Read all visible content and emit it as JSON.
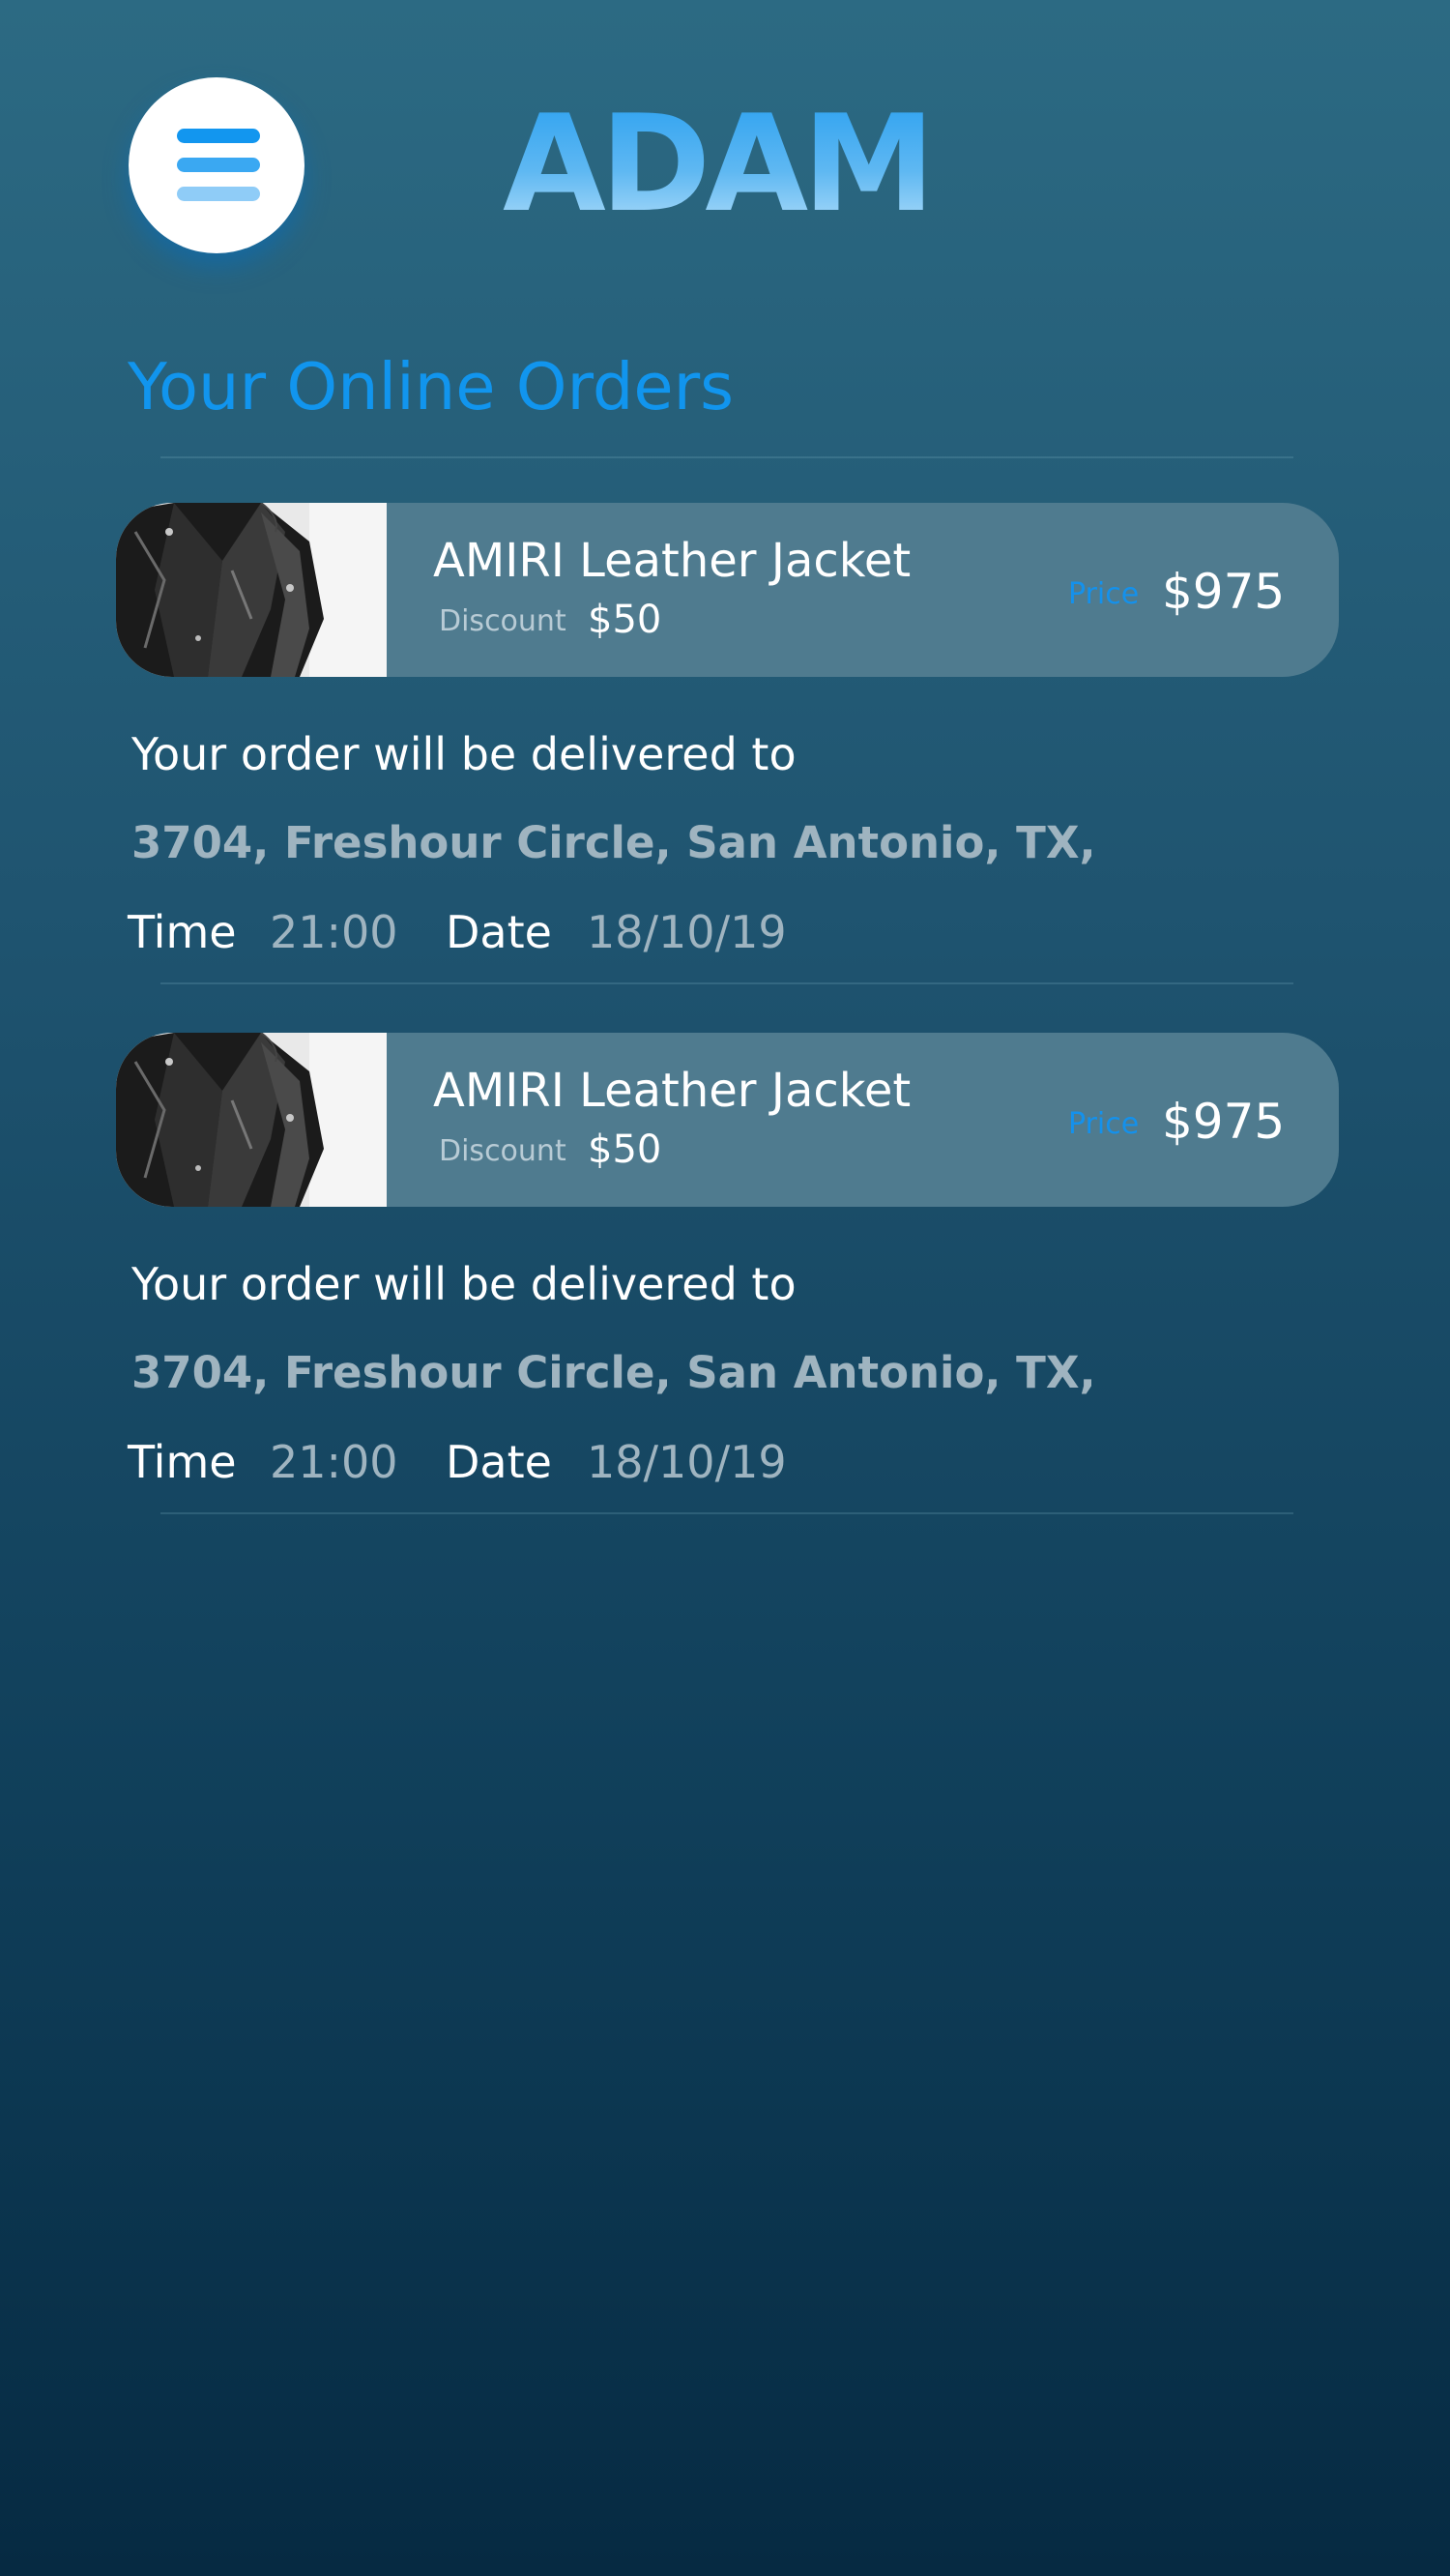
{
  "header": {
    "menu_icon": "hamburger-menu-icon",
    "logo_text": "ADAM",
    "accent_color": "#1195ee"
  },
  "page": {
    "title": "Your Online Orders"
  },
  "orders": [
    {
      "image": "leather-jacket-photo",
      "name": "AMIRI Leather Jacket",
      "discount_label": "Discount",
      "discount_value": "$50",
      "price_label": "Price",
      "price_value": "$975",
      "delivery_heading": "Your order will be delivered to",
      "address": "3704, Freshour Circle, San Antonio, TX,",
      "time_label": "Time",
      "time_value": "21:00",
      "date_label": "Date",
      "date_value": "18/10/19"
    },
    {
      "image": "leather-jacket-photo",
      "name": "AMIRI Leather Jacket",
      "discount_label": "Discount",
      "discount_value": "$50",
      "price_label": "Price",
      "price_value": "$975",
      "delivery_heading": "Your order will be delivered to",
      "address": "3704, Freshour Circle, San Antonio, TX,",
      "time_label": "Time",
      "time_value": "21:00",
      "date_label": "Date",
      "date_value": "18/10/19"
    }
  ]
}
